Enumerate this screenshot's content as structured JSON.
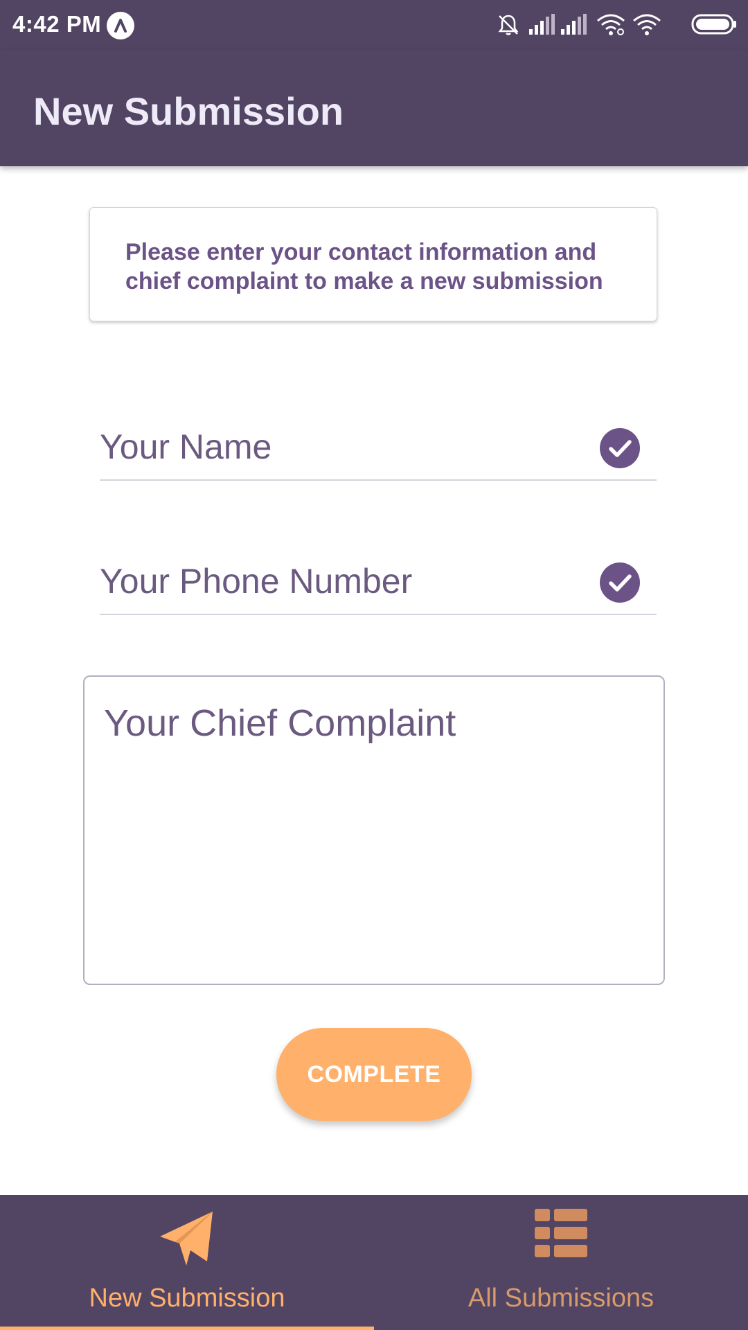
{
  "status_bar": {
    "time": "4:42 PM",
    "icons": [
      "app-notification-icon",
      "bell-muted-icon",
      "signal-icon",
      "signal-icon",
      "wifi-link-icon",
      "wifi-icon",
      "battery-icon"
    ]
  },
  "app_bar": {
    "title": "New Submission"
  },
  "info_card": {
    "text": "Please enter your contact information and chief complaint to make a new submission"
  },
  "form": {
    "name_field": {
      "placeholder": "Your Name",
      "valid": true
    },
    "phone_field": {
      "placeholder": "Your Phone Number",
      "valid": true
    },
    "complaint_field": {
      "placeholder": "Your Chief Complaint"
    },
    "complete_label": "COMPLETE"
  },
  "bottom_nav": {
    "items": [
      {
        "label": "New Submission",
        "icon": "paper-plane-icon",
        "active": true
      },
      {
        "label": "All Submissions",
        "icon": "list-grid-icon",
        "active": false
      }
    ]
  },
  "colors": {
    "primary": "#524463",
    "accent": "#ffb06a",
    "text_purple": "#6b5287"
  }
}
